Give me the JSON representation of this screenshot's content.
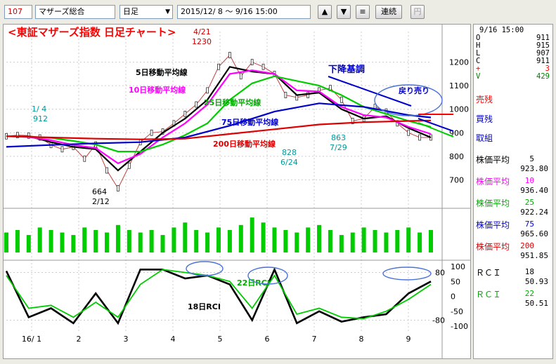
{
  "toolbar": {
    "code": "107",
    "name": "マザーズ総合",
    "period": "日足",
    "range": "2015/12/ 8 ～  9/16 15:00",
    "up_label": "▲",
    "down_label": "▼",
    "menu_label": "≡",
    "renzoku_label": "連続",
    "yen_label": "円"
  },
  "chart_data": {
    "type": "line",
    "title": "<東証マザーズ指数  日足チャート>",
    "ylim": [
      600,
      1300
    ],
    "yticks": [
      700,
      800,
      900,
      1000,
      1100,
      1200
    ],
    "xtick_labels": [
      "16/ 1",
      "2",
      "3",
      "4",
      "5",
      "6",
      "7",
      "8",
      "9"
    ],
    "close": {
      "x": [
        0,
        5,
        10,
        15,
        20,
        25,
        30,
        35,
        40,
        45,
        50,
        55,
        60,
        65,
        70,
        75,
        80,
        85,
        90,
        95,
        100,
        105,
        110,
        115,
        120,
        125,
        130,
        135,
        140,
        145,
        150,
        155,
        160,
        165,
        170,
        175,
        180,
        185,
        190
      ],
      "y": [
        885,
        890,
        888,
        880,
        848,
        830,
        840,
        790,
        850,
        740,
        664,
        760,
        860,
        900,
        905,
        940,
        980,
        1020,
        1080,
        1180,
        1230,
        1140,
        1200,
        1180,
        1150,
        1060,
        1050,
        1060,
        1080,
        1090,
        1040,
        950,
        960,
        1010,
        990,
        940,
        900,
        880,
        880
      ]
    },
    "series": [
      {
        "name": "5日移動平均線",
        "color": "#000000",
        "x": [
          0,
          10,
          20,
          30,
          40,
          50,
          60,
          70,
          80,
          90,
          100,
          110,
          120,
          130,
          140,
          150,
          160,
          170,
          180,
          190
        ],
        "y": [
          885,
          885,
          860,
          840,
          830,
          740,
          820,
          900,
          960,
          1040,
          1180,
          1160,
          1150,
          1060,
          1070,
          1000,
          960,
          970,
          920,
          880
        ]
      },
      {
        "name": "10日移動平均線",
        "color": "#ff00ff",
        "x": [
          0,
          10,
          20,
          30,
          40,
          50,
          60,
          70,
          80,
          90,
          100,
          110,
          120,
          130,
          140,
          150,
          160,
          170,
          180,
          190
        ],
        "y": [
          885,
          882,
          868,
          848,
          835,
          770,
          810,
          880,
          940,
          1020,
          1150,
          1165,
          1150,
          1080,
          1075,
          1010,
          975,
          965,
          925,
          895
        ]
      },
      {
        "name": "25日移動平均線",
        "color": "#00cc00",
        "x": [
          0,
          10,
          20,
          30,
          40,
          50,
          60,
          70,
          80,
          90,
          100,
          110,
          120,
          130,
          140,
          150,
          160,
          170,
          180,
          190
        ],
        "y": [
          885,
          884,
          878,
          865,
          850,
          820,
          820,
          850,
          890,
          940,
          1040,
          1110,
          1140,
          1120,
          1100,
          1060,
          1010,
          980,
          950,
          925
        ]
      },
      {
        "name": "75日移動平均線",
        "color": "#0000cc",
        "x": [
          0,
          20,
          40,
          60,
          80,
          100,
          120,
          140,
          160,
          180,
          190
        ],
        "y": [
          840,
          848,
          855,
          860,
          880,
          930,
          990,
          1025,
          1010,
          975,
          965
        ]
      },
      {
        "name": "200日移動平均線",
        "color": "#dd0000",
        "x": [
          0,
          20,
          40,
          60,
          80,
          100,
          120,
          140,
          160,
          180,
          190
        ],
        "y": [
          885,
          880,
          875,
          872,
          875,
          895,
          915,
          935,
          945,
          950,
          952
        ]
      }
    ],
    "volume": [
      8,
      9,
      7,
      10,
      9,
      8,
      7,
      10,
      9,
      8,
      11,
      9,
      8,
      9,
      7,
      10,
      12,
      9,
      8,
      10,
      9,
      11,
      14,
      12,
      10,
      9,
      8,
      10,
      11,
      9,
      7,
      8,
      10,
      9,
      8,
      9,
      10,
      8,
      9
    ],
    "rci": [
      {
        "name": "18日RCI",
        "color": "#000000",
        "x": [
          0,
          10,
          20,
          30,
          40,
          50,
          60,
          70,
          80,
          90,
          100,
          110,
          120,
          130,
          140,
          150,
          160,
          170,
          180,
          190
        ],
        "y": [
          85,
          -70,
          -40,
          -90,
          10,
          -90,
          90,
          90,
          60,
          70,
          40,
          -80,
          90,
          -90,
          -50,
          -85,
          -70,
          -60,
          10,
          50
        ]
      },
      {
        "name": "22日RCI",
        "color": "#00cc00",
        "x": [
          0,
          10,
          20,
          30,
          40,
          50,
          60,
          70,
          80,
          90,
          100,
          110,
          120,
          130,
          140,
          150,
          160,
          170,
          180,
          190
        ],
        "y": [
          70,
          -40,
          -30,
          -70,
          -20,
          -70,
          40,
          90,
          80,
          70,
          50,
          -40,
          70,
          -60,
          -40,
          -70,
          -75,
          -50,
          -10,
          40
        ]
      }
    ],
    "rci_ticks": [
      "100",
      "50",
      "0",
      "-50",
      "-100",
      "80",
      "-80"
    ],
    "annotations": {
      "label_5": "5日移動平均線",
      "label_10": "10日移動平均線",
      "label_25": "25日移動平均線",
      "label_75": "75日移動平均線",
      "label_200": "200日移動平均線",
      "trend": "下降基調",
      "rebound": "戻り売り",
      "rci18": "18日RCI",
      "rci22": "22日RCI",
      "p1_top": "1/ 4",
      "p1_bot": "912",
      "p2_top": "664",
      "p2_bot": "2/12",
      "p3_top": "4/21",
      "p3_bot": "1230",
      "p4_top": "828",
      "p4_bot": "6/24",
      "p5_top": "863",
      "p5_bot": "7/29"
    }
  },
  "side": {
    "time": "9/16 15:00",
    "ohlc": [
      {
        "k": "O",
        "v": "911"
      },
      {
        "k": "H",
        "v": "915"
      },
      {
        "k": "L",
        "v": "907"
      },
      {
        "k": "C",
        "v": "911"
      },
      {
        "k": "+",
        "v": "3"
      },
      {
        "k": "V",
        "v": "429"
      }
    ],
    "ohlc_colors": [
      "#000",
      "#000",
      "#000",
      "#000",
      "#ff0000",
      "#008000"
    ],
    "sell": "売残",
    "buy": "買残",
    "torikumi": "取組",
    "ma": [
      {
        "label": "株価平均",
        "n": "5",
        "val": "923.80",
        "color": "#000000"
      },
      {
        "label": "株価平均",
        "n": "10",
        "val": "936.40",
        "color": "#ff00ff"
      },
      {
        "label": "株価平均",
        "n": "25",
        "val": "922.24",
        "color": "#00aa00"
      },
      {
        "label": "株価平均",
        "n": "75",
        "val": "965.60",
        "color": "#0000cc"
      },
      {
        "label": "株価平均",
        "n": "200",
        "val": "951.85",
        "color": "#dd0000"
      }
    ],
    "rci": [
      {
        "label": "ＲＣＩ",
        "n": "18",
        "val": "50.93",
        "color": "#000000"
      },
      {
        "label": "ＲＣＩ",
        "n": "22",
        "val": "50.51",
        "color": "#00aa00"
      }
    ]
  }
}
